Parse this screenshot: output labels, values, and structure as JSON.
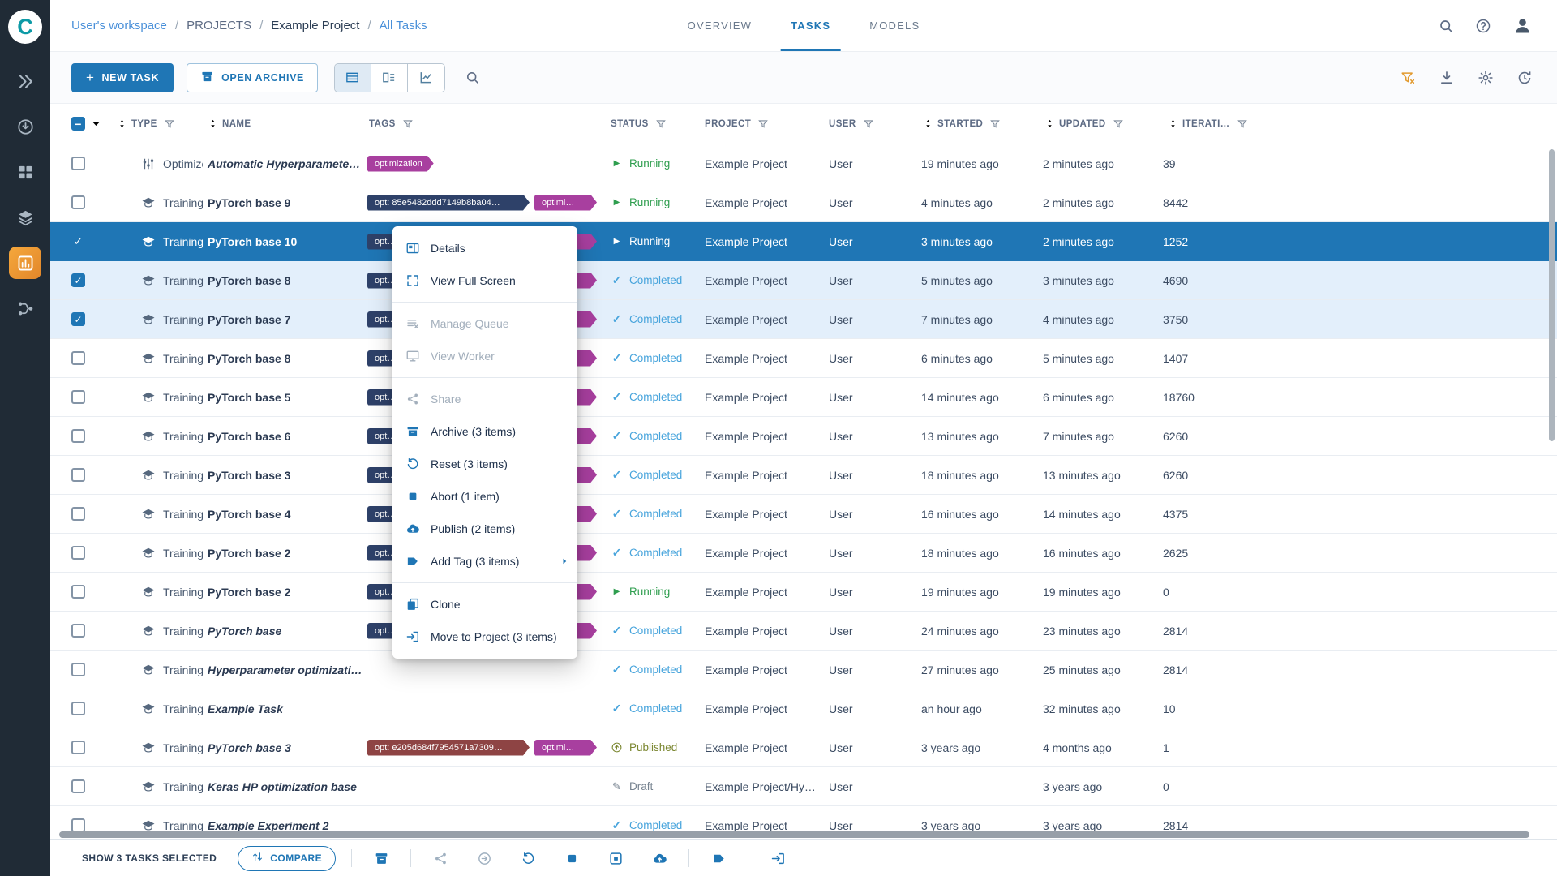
{
  "colors": {
    "accent": "#1f76b5",
    "selected_row": "#1f76b5",
    "running": "#2f9e4f",
    "completed": "#47a4dc",
    "published": "#7b8731",
    "draft": "#76828f",
    "tag_purple": "#a83f9f",
    "tag_dark": "#2e4169",
    "tag_maroon": "#8e4444",
    "sidebar_bg": "#202b36",
    "active_nav": "#ef9d38",
    "filter_clear": "#e29a2e"
  },
  "sidebar": {
    "logo_letter": "C",
    "items": [
      {
        "icon": "getting-started",
        "active": false
      },
      {
        "icon": "serving",
        "active": false
      },
      {
        "icon": "projects",
        "active": false
      },
      {
        "icon": "datasets",
        "active": false
      },
      {
        "icon": "experiments",
        "active": true
      },
      {
        "icon": "pipelines",
        "active": false
      }
    ]
  },
  "breadcrumb": {
    "separator": "/",
    "items": [
      {
        "label": "User's workspace",
        "style": "link"
      },
      {
        "label": "PROJECTS",
        "style": "dim"
      },
      {
        "label": "Example Project",
        "style": "dark"
      },
      {
        "label": "All Tasks",
        "style": "link"
      }
    ]
  },
  "tabs": [
    {
      "label": "OVERVIEW",
      "active": false
    },
    {
      "label": "TASKS",
      "active": true
    },
    {
      "label": "MODELS",
      "active": false
    }
  ],
  "top_actions": [
    {
      "icon": "search"
    },
    {
      "icon": "help"
    },
    {
      "icon": "avatar"
    }
  ],
  "toolbar": {
    "new_task_label": "NEW TASK",
    "open_archive_label": "OPEN ARCHIVE",
    "view_toggles": [
      {
        "icon": "table-view",
        "active": true
      },
      {
        "icon": "card-view",
        "active": false
      },
      {
        "icon": "chart-view",
        "active": false
      }
    ],
    "right_icons": [
      {
        "icon": "clear-filters",
        "color": "#e29a2e"
      },
      {
        "icon": "download"
      },
      {
        "icon": "settings"
      },
      {
        "icon": "auto-refresh"
      }
    ]
  },
  "table": {
    "headers": [
      {
        "label": "TYPE",
        "sort": true,
        "filter": true
      },
      {
        "label": "NAME",
        "sort": true,
        "filter": false
      },
      {
        "label": "TAGS",
        "sort": false,
        "filter": true
      },
      {
        "label": "STATUS",
        "sort": false,
        "filter": true
      },
      {
        "label": "PROJECT",
        "sort": false,
        "filter": true
      },
      {
        "label": "USER",
        "sort": false,
        "filter": true
      },
      {
        "label": "STARTED",
        "sort": true,
        "filter": true
      },
      {
        "label": "UPDATED",
        "sort": true,
        "filter": true
      },
      {
        "label": "ITERATI…",
        "sort": true,
        "filter": true
      }
    ],
    "rows": [
      {
        "type": "Optimizer",
        "type_icon": "optimizer",
        "name": "Automatic Hyperparamete…",
        "italic": true,
        "checked": false,
        "selected": false,
        "tags": [
          {
            "label": "optimization",
            "color": "purple"
          }
        ],
        "status": "Running",
        "status_kind": "running",
        "project": "Example Project",
        "user": "User",
        "started": "19 minutes ago",
        "updated": "2 minutes ago",
        "iterations": "39"
      },
      {
        "type": "Training",
        "type_icon": "training",
        "name": "PyTorch base 9",
        "italic": false,
        "checked": false,
        "selected": false,
        "tags": [
          {
            "label": "opt: 85e5482ddd7149b8ba04…",
            "color": "dark",
            "cls": "hash"
          },
          {
            "label": "optimi…",
            "color": "purple",
            "cls": "mini"
          }
        ],
        "status": "Running",
        "status_kind": "running",
        "project": "Example Project",
        "user": "User",
        "started": "4 minutes ago",
        "updated": "2 minutes ago",
        "iterations": "8442"
      },
      {
        "type": "Training",
        "type_icon": "training",
        "name": "PyTorch base 10",
        "italic": false,
        "checked": true,
        "selected": true,
        "tags": [
          {
            "label": "opt…",
            "color": "dark",
            "cls": "hash"
          },
          {
            "label": "optimi…",
            "color": "purple",
            "cls": "mini"
          }
        ],
        "status": "Running",
        "status_kind": "running",
        "project": "Example Project",
        "user": "User",
        "started": "3 minutes ago",
        "updated": "2 minutes ago",
        "iterations": "1252"
      },
      {
        "type": "Training",
        "type_icon": "training",
        "name": "PyTorch base 8",
        "italic": false,
        "checked": true,
        "selected": false,
        "tags": [
          {
            "label": "opt…",
            "color": "dark",
            "cls": "hash"
          },
          {
            "label": "optimi…",
            "color": "purple",
            "cls": "mini"
          }
        ],
        "status": "Completed",
        "status_kind": "completed",
        "project": "Example Project",
        "user": "User",
        "started": "5 minutes ago",
        "updated": "3 minutes ago",
        "iterations": "4690"
      },
      {
        "type": "Training",
        "type_icon": "training",
        "name": "PyTorch base 7",
        "italic": false,
        "checked": true,
        "selected": false,
        "tags": [
          {
            "label": "opt…",
            "color": "dark",
            "cls": "hash"
          },
          {
            "label": "optimi…",
            "color": "purple",
            "cls": "mini"
          }
        ],
        "status": "Completed",
        "status_kind": "completed",
        "project": "Example Project",
        "user": "User",
        "started": "7 minutes ago",
        "updated": "4 minutes ago",
        "iterations": "3750"
      },
      {
        "type": "Training",
        "type_icon": "training",
        "name": "PyTorch base 8",
        "italic": false,
        "checked": false,
        "selected": false,
        "tags": [
          {
            "label": "opt…",
            "color": "dark",
            "cls": "hash"
          },
          {
            "label": "optimi…",
            "color": "purple",
            "cls": "mini"
          }
        ],
        "status": "Completed",
        "status_kind": "completed",
        "project": "Example Project",
        "user": "User",
        "started": "6 minutes ago",
        "updated": "5 minutes ago",
        "iterations": "1407"
      },
      {
        "type": "Training",
        "type_icon": "training",
        "name": "PyTorch base 5",
        "italic": false,
        "checked": false,
        "selected": false,
        "tags": [
          {
            "label": "opt…",
            "color": "dark",
            "cls": "hash"
          },
          {
            "label": "optimi…",
            "color": "purple",
            "cls": "mini"
          }
        ],
        "status": "Completed",
        "status_kind": "completed",
        "project": "Example Project",
        "user": "User",
        "started": "14 minutes ago",
        "updated": "6 minutes ago",
        "iterations": "18760"
      },
      {
        "type": "Training",
        "type_icon": "training",
        "name": "PyTorch base 6",
        "italic": false,
        "checked": false,
        "selected": false,
        "tags": [
          {
            "label": "opt…",
            "color": "dark",
            "cls": "hash"
          },
          {
            "label": "optimi…",
            "color": "purple",
            "cls": "mini"
          }
        ],
        "status": "Completed",
        "status_kind": "completed",
        "project": "Example Project",
        "user": "User",
        "started": "13 minutes ago",
        "updated": "7 minutes ago",
        "iterations": "6260"
      },
      {
        "type": "Training",
        "type_icon": "training",
        "name": "PyTorch base 3",
        "italic": false,
        "checked": false,
        "selected": false,
        "tags": [
          {
            "label": "opt…",
            "color": "dark",
            "cls": "hash"
          },
          {
            "label": "optimi…",
            "color": "purple",
            "cls": "mini"
          }
        ],
        "status": "Completed",
        "status_kind": "completed",
        "project": "Example Project",
        "user": "User",
        "started": "18 minutes ago",
        "updated": "13 minutes ago",
        "iterations": "6260"
      },
      {
        "type": "Training",
        "type_icon": "training",
        "name": "PyTorch base 4",
        "italic": false,
        "checked": false,
        "selected": false,
        "tags": [
          {
            "label": "opt…",
            "color": "dark",
            "cls": "hash"
          },
          {
            "label": "optimi…",
            "color": "purple",
            "cls": "mini"
          }
        ],
        "status": "Completed",
        "status_kind": "completed",
        "project": "Example Project",
        "user": "User",
        "started": "16 minutes ago",
        "updated": "14 minutes ago",
        "iterations": "4375"
      },
      {
        "type": "Training",
        "type_icon": "training",
        "name": "PyTorch base 2",
        "italic": false,
        "checked": false,
        "selected": false,
        "tags": [
          {
            "label": "opt…",
            "color": "dark",
            "cls": "hash"
          },
          {
            "label": "optimi…",
            "color": "purple",
            "cls": "mini"
          }
        ],
        "status": "Completed",
        "status_kind": "completed",
        "project": "Example Project",
        "user": "User",
        "started": "18 minutes ago",
        "updated": "16 minutes ago",
        "iterations": "2625"
      },
      {
        "type": "Training",
        "type_icon": "training",
        "name": "PyTorch base 2",
        "italic": false,
        "checked": false,
        "selected": false,
        "tags": [
          {
            "label": "opt…",
            "color": "dark",
            "cls": "hash"
          },
          {
            "label": "optimi…",
            "color": "purple",
            "cls": "mini"
          }
        ],
        "status": "Running",
        "status_kind": "running",
        "project": "Example Project",
        "user": "User",
        "started": "19 minutes ago",
        "updated": "19 minutes ago",
        "iterations": "0"
      },
      {
        "type": "Training",
        "type_icon": "training",
        "name": "PyTorch base",
        "italic": true,
        "checked": false,
        "selected": false,
        "tags": [
          {
            "label": "opt…",
            "color": "dark",
            "cls": "hash"
          },
          {
            "label": "optimi…",
            "color": "purple",
            "cls": "mini"
          }
        ],
        "status": "Completed",
        "status_kind": "completed",
        "project": "Example Project",
        "user": "User",
        "started": "24 minutes ago",
        "updated": "23 minutes ago",
        "iterations": "2814"
      },
      {
        "type": "Training",
        "type_icon": "training",
        "name": "Hyperparameter optimizati…",
        "italic": true,
        "checked": false,
        "selected": false,
        "tags": [],
        "status": "Completed",
        "status_kind": "completed",
        "project": "Example Project",
        "user": "User",
        "started": "27 minutes ago",
        "updated": "25 minutes ago",
        "iterations": "2814"
      },
      {
        "type": "Training",
        "type_icon": "training",
        "name": "Example Task",
        "italic": true,
        "checked": false,
        "selected": false,
        "tags": [],
        "status": "Completed",
        "status_kind": "completed",
        "project": "Example Project",
        "user": "User",
        "started": "an hour ago",
        "updated": "32 minutes ago",
        "iterations": "10"
      },
      {
        "type": "Training",
        "type_icon": "training",
        "name": "PyTorch base 3",
        "italic": true,
        "checked": false,
        "selected": false,
        "tags": [
          {
            "label": "opt: e205d684f7954571a7309…",
            "color": "maroon",
            "cls": "hash"
          },
          {
            "label": "optimi…",
            "color": "purple",
            "cls": "mini"
          }
        ],
        "status": "Published",
        "status_kind": "published",
        "project": "Example Project",
        "user": "User",
        "started": "3 years ago",
        "updated": "4 months ago",
        "iterations": "1"
      },
      {
        "type": "Training",
        "type_icon": "training",
        "name": "Keras HP optimization base",
        "italic": true,
        "checked": false,
        "selected": false,
        "tags": [],
        "status": "Draft",
        "status_kind": "draft",
        "project": "Example Project/Hy…",
        "user": "User",
        "started": "",
        "updated": "3 years ago",
        "iterations": "0"
      },
      {
        "type": "Training",
        "type_icon": "training",
        "name": "Example Experiment 2",
        "italic": true,
        "checked": false,
        "selected": false,
        "tags": [],
        "status": "Completed",
        "status_kind": "completed",
        "project": "Example Project",
        "user": "User",
        "started": "3 years ago",
        "updated": "3 years ago",
        "iterations": "2814"
      }
    ]
  },
  "context_menu": {
    "items": [
      {
        "label": "Details",
        "icon": "details"
      },
      {
        "label": "View Full Screen",
        "icon": "fullscreen"
      },
      {
        "divider": true
      },
      {
        "label": "Manage Queue",
        "icon": "queue",
        "disabled": true
      },
      {
        "label": "View Worker",
        "icon": "worker",
        "disabled": true
      },
      {
        "divider": true
      },
      {
        "label": "Share",
        "icon": "share",
        "disabled": true
      },
      {
        "label": "Archive (3 items)",
        "icon": "archive"
      },
      {
        "label": "Reset (3 items)",
        "icon": "reset"
      },
      {
        "label": "Abort (1 item)",
        "icon": "abort"
      },
      {
        "label": "Publish (2 items)",
        "icon": "publish"
      },
      {
        "label": "Add Tag (3 items)",
        "icon": "tag",
        "submenu": true
      },
      {
        "divider": true
      },
      {
        "label": "Clone",
        "icon": "clone"
      },
      {
        "label": "Move to Project (3 items)",
        "icon": "move"
      }
    ]
  },
  "footer": {
    "selected_label": "SHOW 3 TASKS SELECTED",
    "compare_label": "COMPARE",
    "actions": [
      {
        "icon": "archive",
        "divider_before": true
      },
      {
        "icon": "share",
        "disabled": true,
        "divider_before": true
      },
      {
        "icon": "enqueue",
        "disabled": true
      },
      {
        "icon": "reset"
      },
      {
        "icon": "abort"
      },
      {
        "icon": "abort-all"
      },
      {
        "icon": "publish"
      },
      {
        "icon": "tag",
        "divider_before": true
      },
      {
        "icon": "move",
        "divider_before": true
      }
    ]
  }
}
